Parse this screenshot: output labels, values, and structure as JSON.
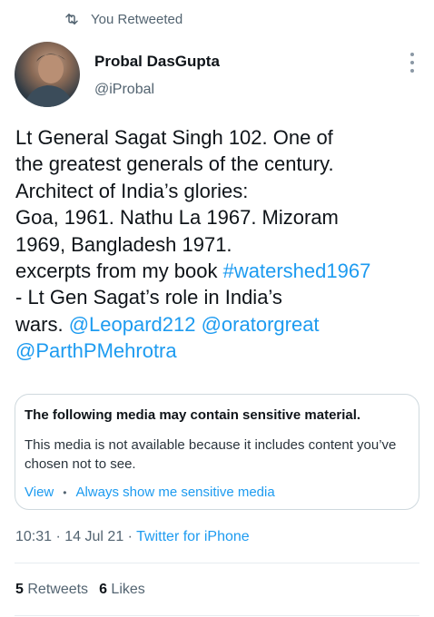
{
  "retweet_banner": {
    "label": "You Retweeted",
    "icon": "retweet-icon"
  },
  "author": {
    "name": "Probal DasGupta",
    "handle": "@iProbal",
    "avatar_icon": "avatar"
  },
  "tweet": {
    "lines": [
      "Lt General Sagat Singh 102. One of",
      "the greatest generals of the century.",
      "Architect of India’s glories:",
      "Goa, 1961. Nathu La 1967. Mizoram",
      "1969, Bangladesh 1971.",
      "excerpts from my book "
    ],
    "hashtag": "#watershed1967",
    "line_after_hashtag": "- Lt Gen Sagat’s role in India’s",
    "wars_prefix": "wars. ",
    "mention_1": "@Leopard212",
    "mention_2": "@oratorgreat",
    "mention_3": "@ParthPMehrotra"
  },
  "sensitive": {
    "title": "The following media may contain sensitive material.",
    "body": "This media is not available because it includes content you’ve chosen not to see.",
    "view_label": "View",
    "separator": "•",
    "always_show_label": "Always show me sensitive media"
  },
  "meta": {
    "time": "10:31",
    "date": "14 Jul 21",
    "separator": "·",
    "source": "Twitter for iPhone"
  },
  "stats": {
    "retweets_count": "5",
    "retweets_label": "Retweets",
    "likes_count": "6",
    "likes_label": "Likes"
  },
  "colors": {
    "link_blue": "#1d9bf0",
    "secondary_text": "#536471",
    "primary_text": "#0f1419",
    "border": "#cfd9de"
  }
}
